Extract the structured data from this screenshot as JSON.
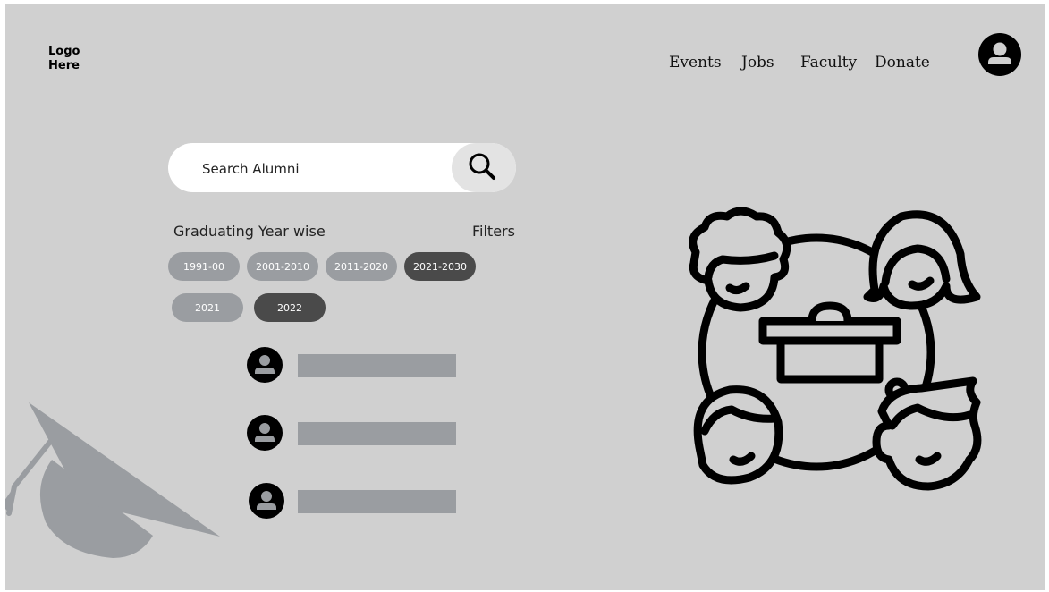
{
  "header": {
    "logo_text": "Logo\nHere",
    "nav": [
      "Events",
      "Jobs",
      "Faculty",
      "Donate"
    ],
    "profile_icon": "user-circle-icon"
  },
  "search": {
    "placeholder": "Search Alumni",
    "icon": "search-icon"
  },
  "filters": {
    "section_label": "Graduating Year wise",
    "filters_label": "Filters",
    "decade_chips": [
      {
        "label": "1991-00",
        "active": false
      },
      {
        "label": "2001-2010",
        "active": false
      },
      {
        "label": "2011-2020",
        "active": false
      },
      {
        "label": "2021-2030",
        "active": true
      }
    ],
    "year_chips": [
      {
        "label": "2021",
        "active": false
      },
      {
        "label": "2022",
        "active": true
      }
    ]
  },
  "results": {
    "icon": "user-circle-icon",
    "rows": 3
  },
  "decorations": {
    "left": "graduation-cap-icon",
    "right": "group-meeting-icon"
  },
  "colors": {
    "background": "#d0d0d0",
    "chip_inactive": "#9a9da1",
    "chip_active": "#4a4a4a",
    "placeholder_bar": "#9a9da1"
  }
}
